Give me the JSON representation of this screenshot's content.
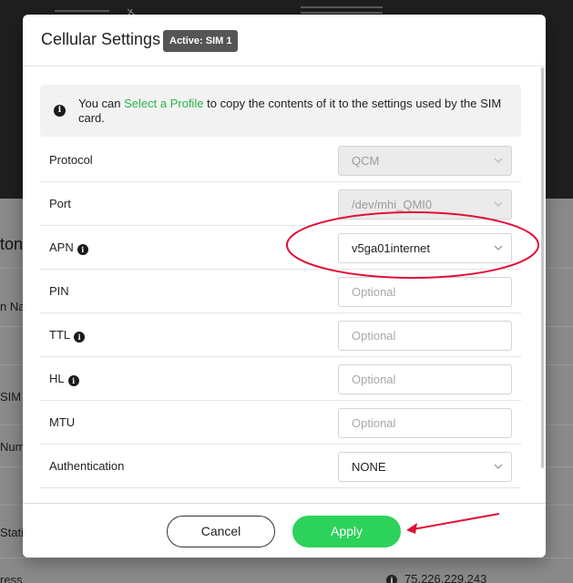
{
  "background": {
    "title_fragment": "ton",
    "row_labels": [
      "n Na",
      "SIM",
      "Num",
      "Stati",
      "ress"
    ],
    "ip_value": "75.226.229.243"
  },
  "modal": {
    "title": "Cellular Settings",
    "badge": "Active: SIM 1",
    "info": {
      "before": "You can ",
      "link": "Select a Profile",
      "after": " to copy the contents of it to the settings used by the SIM card."
    },
    "fields": [
      {
        "label": "Protocol",
        "value": "QCM",
        "type": "select",
        "disabled": true
      },
      {
        "label": "Port",
        "value": "/dev/mhi_QMI0",
        "type": "select",
        "disabled": true
      },
      {
        "label": "APN",
        "value": "v5ga01internet",
        "type": "select",
        "info": true
      },
      {
        "label": "PIN",
        "placeholder": "Optional",
        "type": "input"
      },
      {
        "label": "TTL",
        "placeholder": "Optional",
        "type": "input",
        "info": true
      },
      {
        "label": "HL",
        "placeholder": "Optional",
        "type": "input",
        "info": true
      },
      {
        "label": "MTU",
        "placeholder": "Optional",
        "type": "input"
      },
      {
        "label": "Authentication",
        "value": "NONE",
        "type": "select"
      }
    ],
    "footer": {
      "cancel_label": "Cancel",
      "apply_label": "Apply"
    }
  },
  "icons": {
    "info": "info-icon",
    "chevron": "chevron-down-icon"
  },
  "colors": {
    "accent": "#2cd25a",
    "link": "#2bb24c",
    "annotation": "#e0103a"
  }
}
